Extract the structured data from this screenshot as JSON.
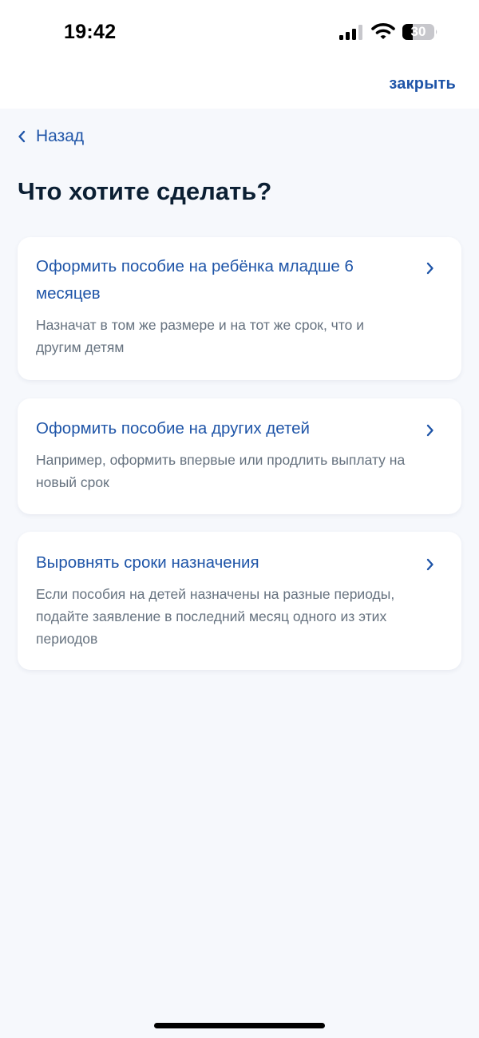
{
  "status_bar": {
    "time": "19:42",
    "battery_level": "30",
    "icons": [
      "cellular-signal-icon",
      "wifi-icon",
      "battery-icon"
    ]
  },
  "header": {
    "close_label": "закрыть"
  },
  "nav": {
    "back_label": "Назад"
  },
  "page": {
    "title": "Что хотите сделать?"
  },
  "options": [
    {
      "title": "Оформить пособие на ребёнка младше 6 месяцев",
      "description": "Назначат в том же размере и на тот же срок, что и другим детям"
    },
    {
      "title": "Оформить пособие на других детей",
      "description": "Например, оформить впервые или продлить выплату на новый срок"
    },
    {
      "title": "Выровнять сроки назначения",
      "description": "Если пособия на детей назначены на разные периоды, подайте заявление в последний месяц одного из этих периодов"
    }
  ],
  "colors": {
    "accent": "#1f55a8",
    "title": "#0b1f33",
    "secondary_text": "#66727f",
    "background": "#f6f8fc",
    "card": "#ffffff"
  }
}
